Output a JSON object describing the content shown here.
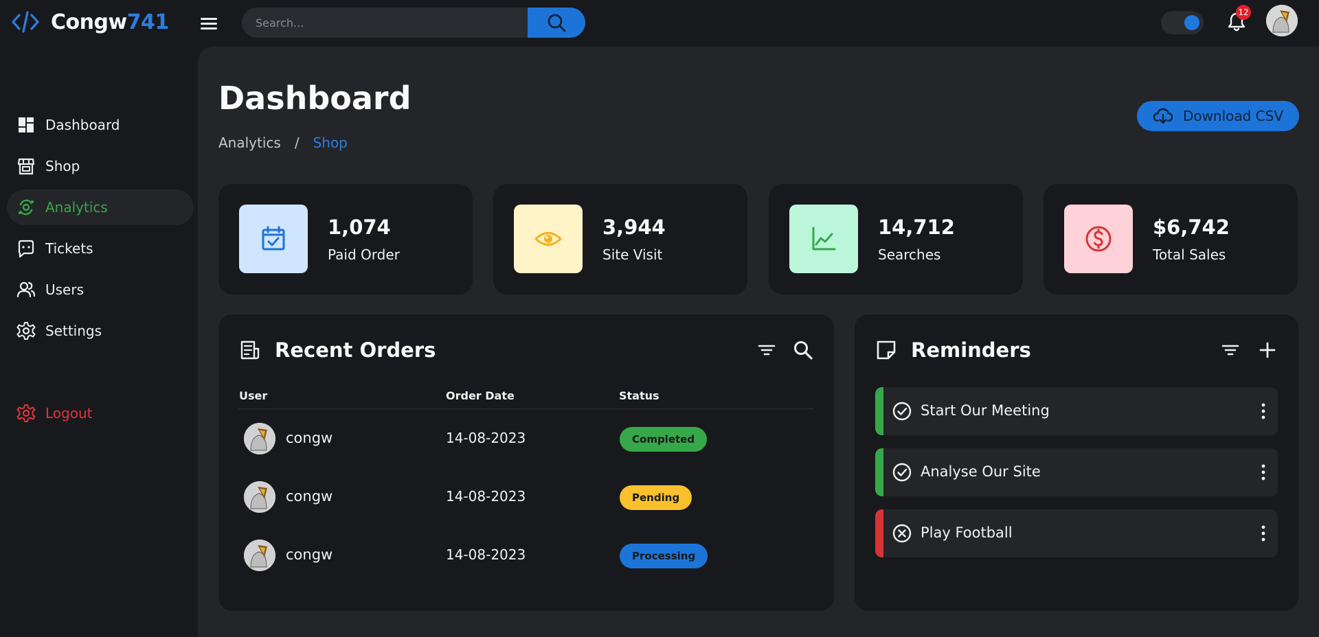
{
  "brand": {
    "name": "Congw",
    "accent": "741"
  },
  "search": {
    "placeholder": "Search..."
  },
  "notifications": {
    "count": "12"
  },
  "sidebar": {
    "items": [
      {
        "label": "Dashboard",
        "icon": "dashboard-icon"
      },
      {
        "label": "Shop",
        "icon": "store-icon"
      },
      {
        "label": "Analytics",
        "icon": "analytics-icon",
        "active": true
      },
      {
        "label": "Tickets",
        "icon": "message-icon"
      },
      {
        "label": "Users",
        "icon": "group-icon"
      },
      {
        "label": "Settings",
        "icon": "gear-icon"
      }
    ],
    "logout_label": "Logout"
  },
  "header": {
    "title": "Dashboard",
    "breadcrumb": [
      "Analytics",
      "/",
      "Shop"
    ],
    "download_label": "Download CSV"
  },
  "stats": [
    {
      "value": "1,074",
      "label": "Paid Order",
      "icon": "calendar-check-icon",
      "bg": "#d0e5ff",
      "fg": "#1d74d8"
    },
    {
      "value": "3,944",
      "label": "Site Visit",
      "icon": "eye-icon",
      "bg": "#fff3c8",
      "fg": "#f4b31d"
    },
    {
      "value": "14,712",
      "label": "Searches",
      "icon": "line-chart-icon",
      "bg": "#bbf6db",
      "fg": "#36a84a"
    },
    {
      "value": "$6,742",
      "label": "Total Sales",
      "icon": "dollar-circle-icon",
      "bg": "#ffd1d8",
      "fg": "#d83434"
    }
  ],
  "orders": {
    "title": "Recent Orders",
    "columns": [
      "User",
      "Order Date",
      "Status"
    ],
    "rows": [
      {
        "user": "congw",
        "date": "14-08-2023",
        "status": "Completed",
        "color": "#36a84a"
      },
      {
        "user": "congw",
        "date": "14-08-2023",
        "status": "Pending",
        "color": "#fbc02d"
      },
      {
        "user": "congw",
        "date": "14-08-2023",
        "status": "Processing",
        "color": "#1d74d8"
      }
    ]
  },
  "reminders": {
    "title": "Reminders",
    "items": [
      {
        "text": "Start Our Meeting",
        "state": "done",
        "color": "#36a84a"
      },
      {
        "text": "Analyse Our Site",
        "state": "done",
        "color": "#36a84a"
      },
      {
        "text": "Play Football",
        "state": "cancelled",
        "color": "#d83434"
      }
    ]
  },
  "colors": {
    "accent": "#1d74d8",
    "active": "#36a84a",
    "danger": "#e0353b"
  }
}
